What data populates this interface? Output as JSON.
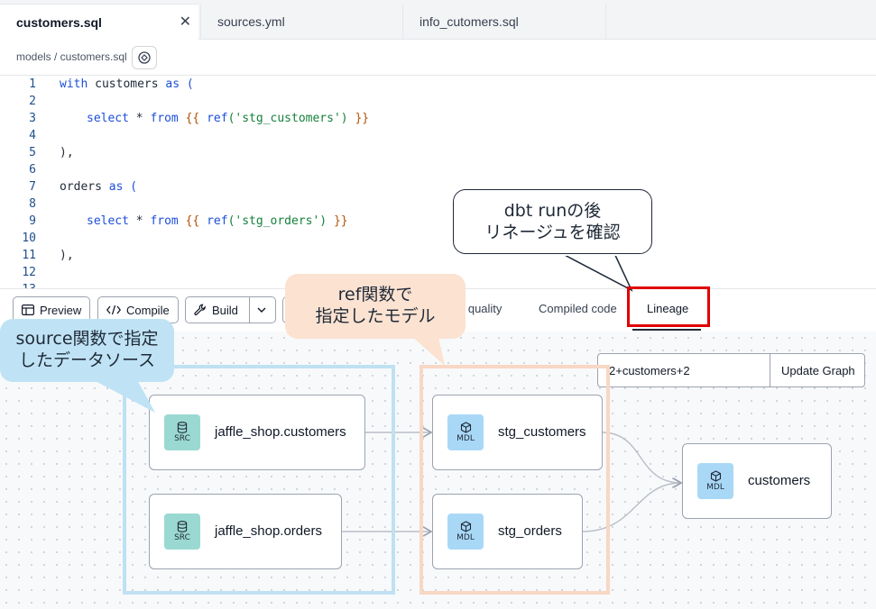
{
  "tabs": [
    {
      "label": "customers.sql",
      "active": true
    },
    {
      "label": "sources.yml",
      "active": false
    },
    {
      "label": "info_cutomers.sql",
      "active": false
    }
  ],
  "tab_close_glyph": "✕",
  "breadcrumb": "models / customers.sql",
  "code_lines": [
    {
      "n": "1"
    },
    {
      "n": "2"
    },
    {
      "n": "3"
    },
    {
      "n": "4"
    },
    {
      "n": "5"
    },
    {
      "n": "6"
    },
    {
      "n": "7"
    },
    {
      "n": "8"
    },
    {
      "n": "9"
    },
    {
      "n": "10"
    },
    {
      "n": "11"
    },
    {
      "n": "12"
    },
    {
      "n": "13"
    }
  ],
  "code": {
    "l1_kw1": "with",
    "l1_id": " customers ",
    "l1_kw2": "as",
    "l1_p": " (",
    "l3_kw1": "select",
    "l3_star": " * ",
    "l3_kw2": "from",
    "l3_b1": " {{ ",
    "l3_fn": "ref",
    "l3_str": "('stg_customers')",
    "l3_b2": " }}",
    "l5": "),",
    "l7_id": "orders ",
    "l7_kw": "as",
    "l7_p": " (",
    "l9_kw1": "select",
    "l9_star": " * ",
    "l9_kw2": "from",
    "l9_b1": " {{ ",
    "l9_fn": "ref",
    "l9_str": "('stg_orders')",
    "l9_b2": " }}",
    "l11": "),"
  },
  "toolbar": {
    "preview": "Preview",
    "compile": "Compile",
    "build": "Build",
    "data_quality": "e quality",
    "compiled_code": "Compiled code",
    "lineage": "Lineage"
  },
  "graph": {
    "selector": "2+customers+2",
    "update_button": "Update Graph",
    "nodes": {
      "src_customers": {
        "label": "jaffle_shop.customers",
        "badge": "SRC"
      },
      "src_orders": {
        "label": "jaffle_shop.orders",
        "badge": "SRC"
      },
      "stg_customers": {
        "label": "stg_customers",
        "badge": "MDL"
      },
      "stg_orders": {
        "label": "stg_orders",
        "badge": "MDL"
      },
      "customers": {
        "label": "customers",
        "badge": "MDL"
      }
    }
  },
  "annotations": {
    "source_callout": [
      "source関数で指定",
      "したデータソース"
    ],
    "ref_callout": [
      "ref関数で",
      "指定したモデル"
    ],
    "lineage_callout": [
      "dbt runの後",
      "リネージュを確認"
    ],
    "highlight_color": "#e00000"
  }
}
